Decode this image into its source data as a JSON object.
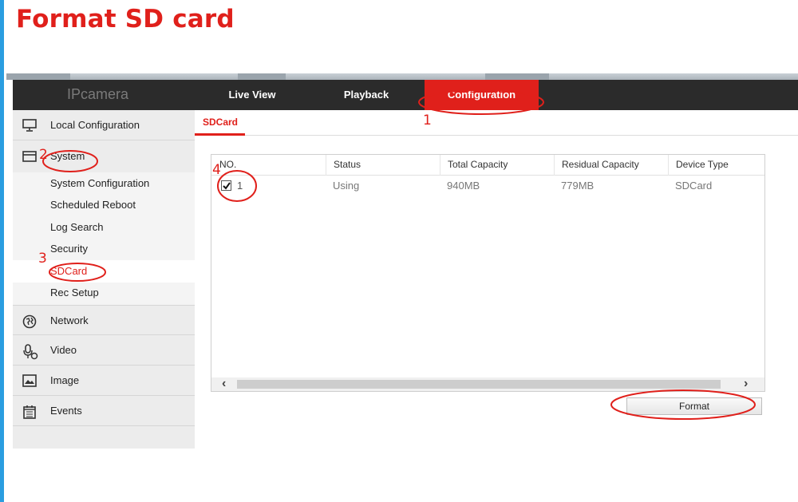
{
  "title": "Format SD card",
  "brand": "IPcamera",
  "nav": {
    "live_view": "Live View",
    "playback": "Playback",
    "configuration": "Configuration"
  },
  "sidebar": {
    "items": [
      {
        "label": "Local Configuration",
        "icon": "monitor-icon"
      },
      {
        "label": "System",
        "icon": "window-icon"
      },
      {
        "label": "Network",
        "icon": "globe-icon"
      },
      {
        "label": "Video",
        "icon": "microphone-icon"
      },
      {
        "label": "Image",
        "icon": "picture-icon"
      },
      {
        "label": "Events",
        "icon": "calendar-icon"
      }
    ],
    "system_sub": [
      "System Configuration",
      "Scheduled Reboot",
      "Log Search",
      "Security",
      "SDCard",
      "Rec Setup"
    ]
  },
  "content": {
    "tab": "SDCard",
    "table": {
      "headers": [
        "NO.",
        "Status",
        "Total Capacity",
        "Residual Capacity",
        "Device Type"
      ],
      "rows": [
        {
          "no": "1",
          "status": "Using",
          "total": "940MB",
          "residual": "779MB",
          "device_type": "SDCard",
          "checked": true
        }
      ]
    },
    "format_button": "Format"
  },
  "annotations": [
    "1",
    "2",
    "3",
    "4"
  ],
  "colors": {
    "accent_red": "#e0201b",
    "nav_bg": "#2b2b2b",
    "left_accent_blue": "#2a9de0"
  }
}
